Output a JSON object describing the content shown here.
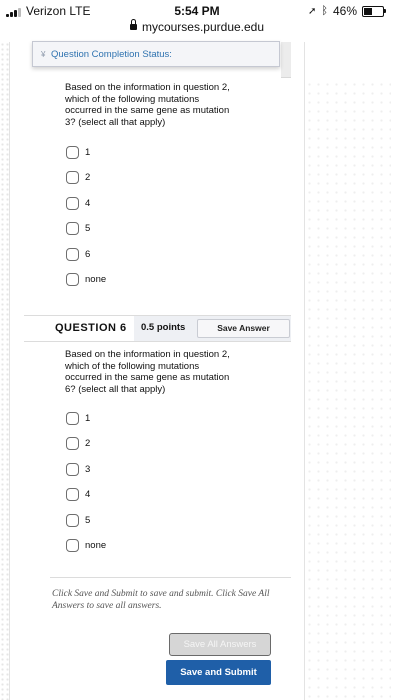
{
  "status_bar": {
    "carrier": "Verizon  LTE",
    "time": "5:54 PM",
    "url": "mycourses.purdue.edu",
    "battery": "46%",
    "battery_level": 0.46
  },
  "completion": {
    "label": "Question Completion Status:"
  },
  "question5": {
    "prompt": "Based on the information in question 2, which of the following mutations occurred in the same gene as mutation 3? (select all that apply)",
    "options": [
      "1",
      "2",
      "4",
      "5",
      "6",
      "none"
    ]
  },
  "question6": {
    "title": "QUESTION 6",
    "points": "0.5 points",
    "save_label": "Save Answer",
    "prompt": "Based on the information in question 2, which of the following mutations occurred in the same gene as mutation 6? (select all that apply)",
    "options": [
      "1",
      "2",
      "3",
      "4",
      "5",
      "none"
    ]
  },
  "footer": {
    "note": "Click Save and Submit to save and submit. Click Save All Answers to save all answers.",
    "save_all_label": "Save All Answers",
    "submit_label": "Save and Submit"
  },
  "colors": {
    "accent": "#1f5fa8",
    "link": "#2f73b0"
  }
}
